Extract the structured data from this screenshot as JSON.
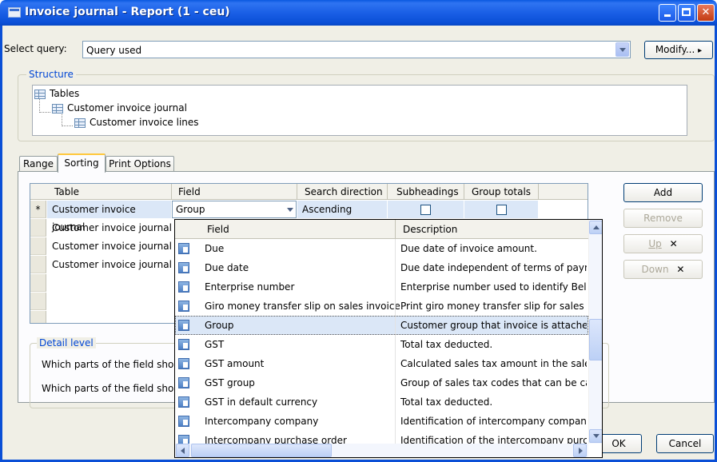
{
  "window": {
    "title": "Invoice journal - Report (1 - ceu)"
  },
  "query": {
    "label": "Select query:",
    "value": "Query used",
    "modify_label": "Modify...",
    "modify_arrow": "▸"
  },
  "structure": {
    "title": "Structure",
    "nodes": [
      "Tables",
      "Customer invoice journal",
      "Customer invoice lines"
    ]
  },
  "tabs": [
    "Range",
    "Sorting",
    "Print Options"
  ],
  "sorting": {
    "columns": [
      "Table",
      "Field",
      "Search direction",
      "Subheadings",
      "Group totals"
    ],
    "row_marker": "*",
    "rows": [
      {
        "table": "Customer invoice journal",
        "field": "Group",
        "direction": "Ascending"
      },
      {
        "table": "Customer invoice journal"
      },
      {
        "table": "Customer invoice journal"
      },
      {
        "table": "Customer invoice journal"
      }
    ]
  },
  "side_buttons": {
    "add": "Add",
    "remove": "Remove",
    "up": "Up",
    "down": "Down",
    "x_glyph": "✕"
  },
  "detail": {
    "title": "Detail level",
    "q1": "Which parts of the field shou",
    "q2": "Which parts of the field shou"
  },
  "lookup": {
    "col_field": "Field",
    "col_desc": "Description",
    "rows": [
      {
        "field": "Due",
        "desc": "Due date of invoice amount."
      },
      {
        "field": "Due date",
        "desc": "Due date independent of terms of paym"
      },
      {
        "field": "Enterprise number",
        "desc": "Enterprise number used to identify Belgi"
      },
      {
        "field": "Giro money transfer slip on sales invoice",
        "desc": "Print giro money transfer slip for sales in"
      },
      {
        "field": "Group",
        "desc": "Customer group that invoice is attached"
      },
      {
        "field": "GST",
        "desc": "Total tax deducted."
      },
      {
        "field": "GST amount",
        "desc": "Calculated sales tax amount in the sales"
      },
      {
        "field": "GST group",
        "desc": "Group of sales tax codes that can be cal"
      },
      {
        "field": "GST in default currency",
        "desc": "Total tax deducted."
      },
      {
        "field": "Intercompany company",
        "desc": "Identification of intercompany company"
      },
      {
        "field": "Intercompany purchase order",
        "desc": "Identification of the intercompany purch"
      }
    ],
    "selected_index": 4,
    "vscroll_position": 0.55
  },
  "footer": {
    "ok": "OK",
    "cancel": "Cancel"
  },
  "colors": {
    "title_bar": "#0a4fd6",
    "group_title": "#0046d5",
    "selection": "#dbe7f7"
  }
}
